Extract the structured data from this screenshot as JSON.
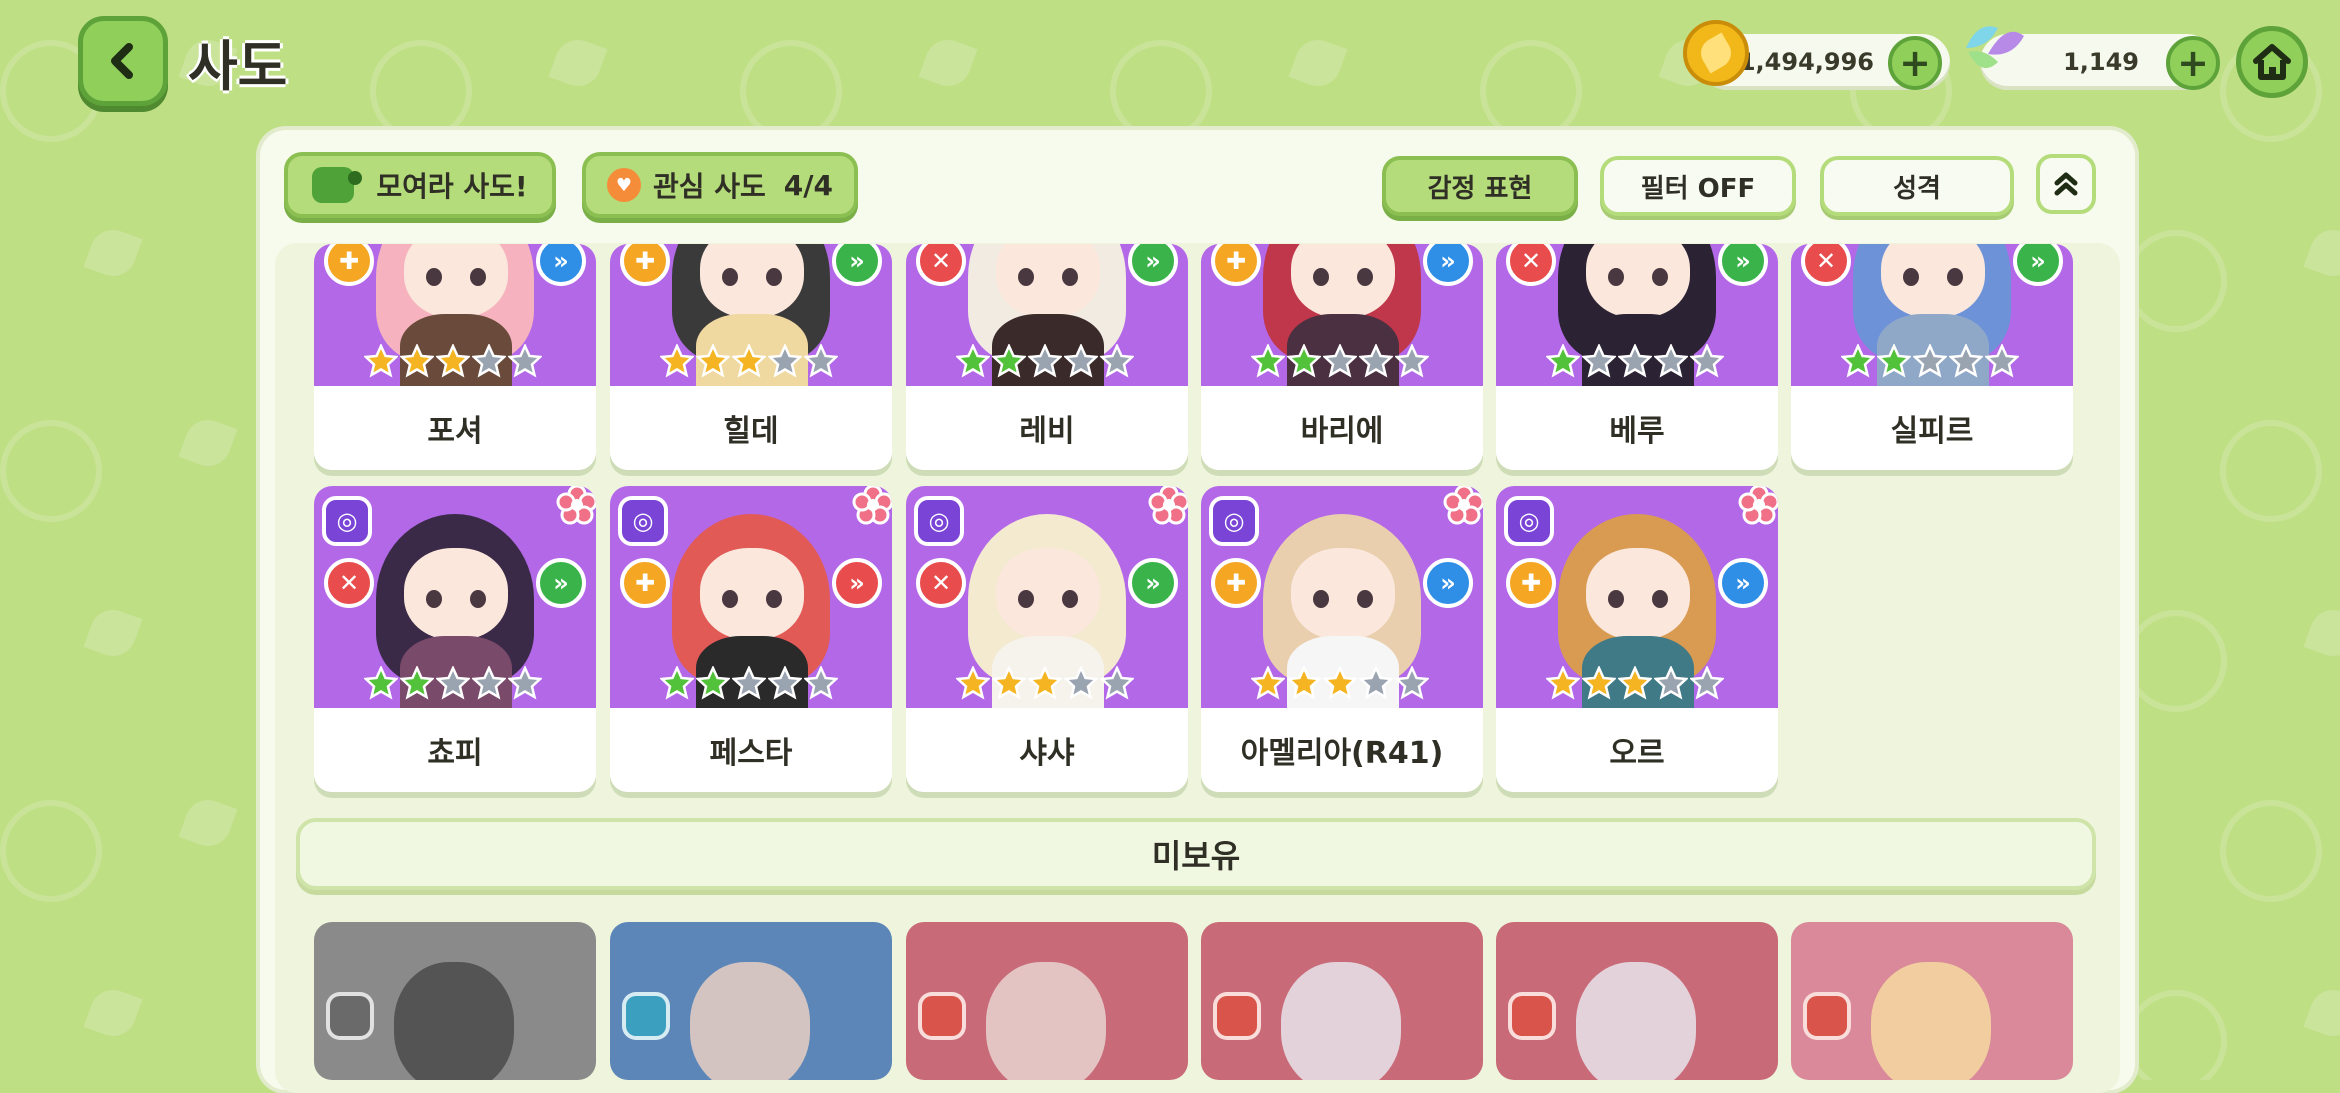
{
  "header": {
    "title": "사도"
  },
  "currency": {
    "gold": "1,494,996",
    "gem": "1,149",
    "plus": "+"
  },
  "panel": {
    "gather_button": "모여라 사도!",
    "favorite_button": {
      "label": "관심 사도",
      "count": "4/4"
    },
    "emotion_button": "감정 표현",
    "filter_button": "필터 OFF",
    "personality_button": "성격",
    "collapse_icon": "double-chevron-up-icon"
  },
  "owned_row1": [
    {
      "name": "포셔",
      "stars": 3,
      "role": "plus",
      "speed": "blue",
      "hair": "#f6b3bf",
      "body": "#6a4a3a"
    },
    {
      "name": "힐데",
      "stars": 3,
      "role": "plus",
      "speed": "green",
      "hair": "#3a3a3a",
      "body": "#f0d9a0"
    },
    {
      "name": "레비",
      "stars": 2,
      "role": "x",
      "speed": "green",
      "hair": "#f1ebe2",
      "body": "#3a2a2a"
    },
    {
      "name": "바리에",
      "stars": 2,
      "role": "plus",
      "speed": "blue",
      "hair": "#c0364a",
      "body": "#4a3040"
    },
    {
      "name": "베루",
      "stars": 1,
      "role": "x",
      "speed": "green",
      "hair": "#2b2233",
      "body": "#2b2233"
    },
    {
      "name": "실피르",
      "stars": 2,
      "role": "x",
      "speed": "green",
      "hair": "#6d92d8",
      "body": "#90a8c8"
    }
  ],
  "owned_row2": [
    {
      "name": "쵸피",
      "stars": 2,
      "role": "x",
      "speed": "green",
      "hair": "#3a2a48",
      "body": "#7a4a6a"
    },
    {
      "name": "페스타",
      "stars": 2,
      "role": "plus",
      "speed": "red",
      "hair": "#e25a56",
      "body": "#2a2a2a"
    },
    {
      "name": "샤샤",
      "stars": 3,
      "role": "x",
      "speed": "green",
      "hair": "#f3ead0",
      "body": "#f6f2ec"
    },
    {
      "name": "아멜리아(R41)",
      "stars": 3,
      "role": "plus",
      "speed": "blue",
      "hair": "#e9cfae",
      "body": "#f6f6f6"
    },
    {
      "name": "오르",
      "stars": 3,
      "role": "plus",
      "speed": "blue",
      "hair": "#d99a52",
      "body": "#3f7a86"
    }
  ],
  "section_unowned": "미보유",
  "unowned": [
    {
      "bg": "#8a8a8a",
      "badge": "#6a6a6a",
      "face": "#4a4a4a"
    },
    {
      "bg": "#5c86b8",
      "badge": "#3b9fbf",
      "face": "#e7cfc2"
    },
    {
      "bg": "#c86a78",
      "badge": "#d9544a",
      "face": "#e9d4cf"
    },
    {
      "bg": "#c86a78",
      "badge": "#d9544a",
      "face": "#e8e4ea"
    },
    {
      "bg": "#c86a78",
      "badge": "#d9544a",
      "face": "#e8e4ea"
    },
    {
      "bg": "#d9899a",
      "badge": "#d9544a",
      "face": "#f4d9a0"
    }
  ],
  "colors": {
    "accent_green": "#8fcf5a",
    "card_purple": "#b368e8",
    "star_gold": "#f5b523",
    "star_green": "#53c23b",
    "star_empty": "#9aa3b0"
  }
}
